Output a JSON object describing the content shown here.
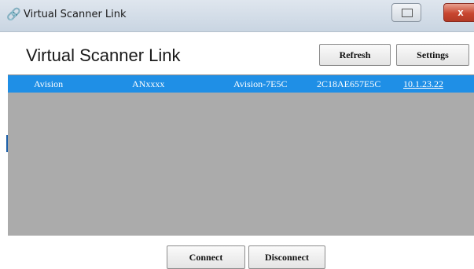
{
  "window": {
    "title": "Virtual Scanner Link",
    "icon": "link-icon",
    "close_glyph": "x"
  },
  "header": {
    "title": "Virtual Scanner Link",
    "refresh_label": "Refresh",
    "settings_label": "Settings"
  },
  "scanners": [
    {
      "brand": "Avision",
      "model": "ANxxxx",
      "name": "Avision-7E5C",
      "mac": "2C18AE657E5C",
      "ip": "10.1.23.22",
      "selected": true
    }
  ],
  "footer": {
    "connect_label": "Connect",
    "disconnect_label": "Disconnect"
  },
  "colors": {
    "selection": "#1f8fe6",
    "list_background": "#ababab",
    "close_button": "#c84630"
  }
}
